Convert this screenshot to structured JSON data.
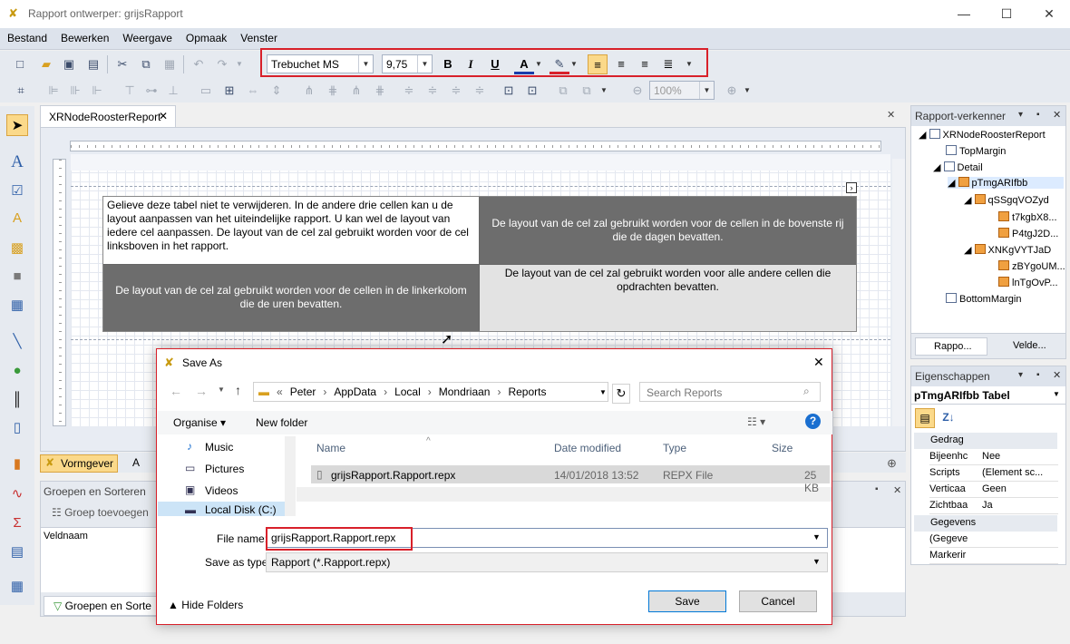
{
  "app": {
    "title": "Rapport ontwerper: grijsRapport"
  },
  "menu": [
    "Bestand",
    "Bewerken",
    "Weergave",
    "Opmaak",
    "Venster"
  ],
  "format_toolbar": {
    "font": "Trebuchet MS",
    "size": "9,75",
    "zoom": "100%"
  },
  "doc_tab": {
    "label": "XRNodeRoosterReport"
  },
  "report_table": {
    "cell1": "Gelieve deze tabel niet te verwijderen. In de andere drie cellen kan u de layout aanpassen van het uiteindelijke rapport. U kan wel de layout van iedere cel aanpassen. De layout van de cel zal gebruikt worden voor de cel linksboven in het rapport.",
    "cell2": "De layout van de cel zal gebruikt worden voor de cellen in de bovenste rij die de dagen bevatten.",
    "cell3": "De layout van de cel zal gebruikt worden voor de cellen in de linkerkolom die de uren bevatten.",
    "cell4": "De layout van de cel zal gebruikt worden voor alle andere cellen die opdrachten bevatten."
  },
  "bottom_tabs": {
    "vormgever": "Vormgever",
    "other": "A"
  },
  "groups": {
    "title": "Groepen en Sorteren",
    "add": "Groep toevoegen",
    "col": "Veldnaam",
    "tab": "Groepen en Sorte"
  },
  "explorer": {
    "title": "Rapport-verkenner",
    "nodes": [
      "XRNodeRoosterReport",
      "TopMargin",
      "Detail",
      "pTmgARIfbb",
      "qSSgqVOZyd",
      "t7kgbX8...",
      "P4tgJ2D...",
      "XNKgVYTJaD",
      "zBYgoUM...",
      "lnTgOvP...",
      "BottomMargin"
    ],
    "tab1": "Rappo...",
    "tab2": "Velde..."
  },
  "properties": {
    "title": "Eigenschappen",
    "object": "pTmgARIfbb  Tabel",
    "cat1": "Gedrag",
    "rows1": [
      [
        "Bijeenhc",
        "Nee"
      ],
      [
        "Scripts",
        "(Element sc..."
      ],
      [
        "Verticaa",
        "Geen"
      ],
      [
        "Zichtbaa",
        "Ja"
      ]
    ],
    "cat2": "Gegevens",
    "rows2": [
      [
        "(Gegeve",
        ""
      ],
      [
        "Markerir",
        ""
      ]
    ]
  },
  "dialog": {
    "title": "Save As",
    "path": [
      "Peter",
      "AppData",
      "Local",
      "Mondriaan",
      "Reports"
    ],
    "search_placeholder": "Search Reports",
    "organise": "Organise",
    "new_folder": "New folder",
    "nav": [
      "Music",
      "Pictures",
      "Videos",
      "Local Disk (C:)"
    ],
    "columns": [
      "Name",
      "Date modified",
      "Type",
      "Size"
    ],
    "file": {
      "name": "grijsRapport.Rapport.repx",
      "date": "14/01/2018 13:52",
      "type": "REPX File",
      "size": "25 KB"
    },
    "file_name_label": "File name:",
    "file_name_value": "grijsRapport.Rapport.repx",
    "save_type_label": "Save as type:",
    "save_type_value": "Rapport (*.Rapport.repx)",
    "hide_folders": "Hide Folders",
    "save": "Save",
    "cancel": "Cancel"
  }
}
